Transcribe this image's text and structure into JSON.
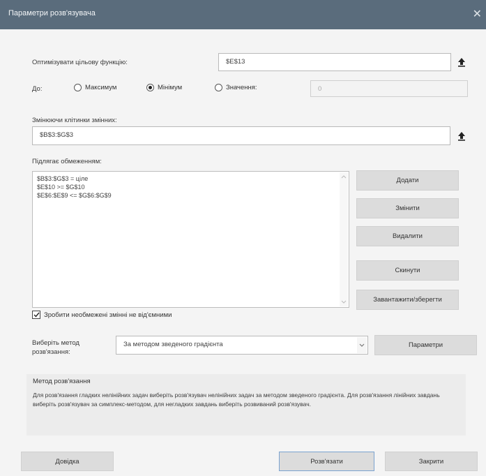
{
  "window": {
    "title": "Параметри розв'язувача",
    "close_glyph": "✕"
  },
  "objective": {
    "label": "Оптимізувати цільову функцію:",
    "value": "$E$13"
  },
  "to": {
    "label": "До:",
    "options": [
      {
        "label": "Максимум",
        "selected": false
      },
      {
        "label": "Мінімум",
        "selected": true
      },
      {
        "label": "Значення:",
        "selected": false
      }
    ],
    "value": "0"
  },
  "variables": {
    "label": "Змінюючи клітинки змінних:",
    "value": "$B$3:$G$3"
  },
  "constraints": {
    "label": "Підлягає обмеженням:",
    "items": [
      "$B$3:$G$3 = ціле",
      "$E$10 >= $G$10",
      "$E$6:$E$9 <= $G$6:$G$9"
    ]
  },
  "side_buttons": {
    "add": "Додати",
    "change": "Змінити",
    "delete": "Видалити",
    "reset": "Скинути",
    "load_save": "Завантажити/зберегти"
  },
  "nonneg": {
    "label": "Зробити необмежені змінні не від'ємними",
    "checked": true
  },
  "method": {
    "label_line1": "Виберіть метод",
    "label_line2": "розв'язання:",
    "value": "За методом зведеного градієнта",
    "options_button": "Параметри"
  },
  "method_info": {
    "title": "Метод розв'язання",
    "text": "Для розв'язання гладких нелінійних задач виберіть розв'язувач нелінійних задач за методом зведеного градієнта. Для розв'язання лінійних завдань виберіть розв'язувач за симплекс-методом, для негладких завдань виберіть розвиваний розв'язувач."
  },
  "footer": {
    "help": "Довідка",
    "solve": "Розв'язати",
    "close": "Закрити"
  },
  "icons": {
    "collapse": "range-collapse-icon",
    "dropdown": "chevron-down-icon"
  },
  "colors": {
    "titlebar": "#5a6c7c",
    "dialog": "#f4f4f4",
    "button": "#dcdcdc",
    "default_border": "#7aa2cf"
  }
}
